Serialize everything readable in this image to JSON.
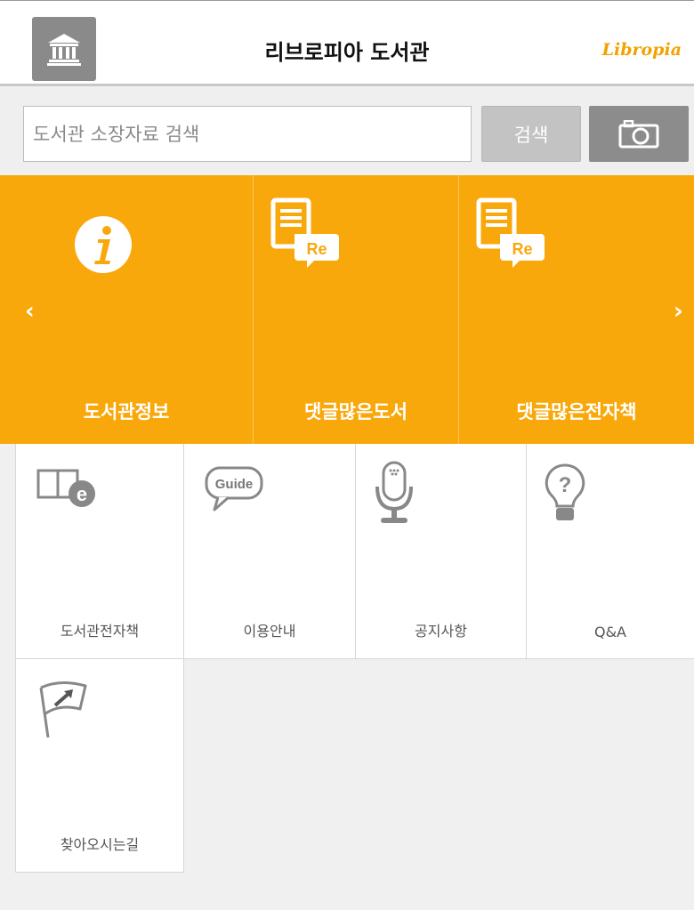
{
  "header": {
    "title": "리브로피아 도서관",
    "brand": "Libropia",
    "home_icon": "library-building-icon"
  },
  "search": {
    "placeholder": "도서관 소장자료 검색",
    "button_label": "검색",
    "camera_icon": "camera-icon"
  },
  "banner": {
    "items": [
      {
        "label": "도서관정보",
        "icon": "info-icon"
      },
      {
        "label": "댓글많은도서",
        "icon": "review-document-icon"
      },
      {
        "label": "댓글많은전자책",
        "icon": "review-document-icon"
      }
    ],
    "prev_arrow": "‹",
    "next_arrow": "›",
    "color": "#f8a80a"
  },
  "menu": {
    "items": [
      {
        "label": "도서관전자책",
        "icon": "ebook-icon"
      },
      {
        "label": "이용안내",
        "icon": "guide-bubble-icon",
        "icon_text": "Guide"
      },
      {
        "label": "공지사항",
        "icon": "microphone-icon"
      },
      {
        "label": "Q&A",
        "icon": "lightbulb-question-icon",
        "icon_text": "?"
      },
      {
        "label": "찾아오시는길",
        "icon": "flag-icon"
      }
    ]
  }
}
